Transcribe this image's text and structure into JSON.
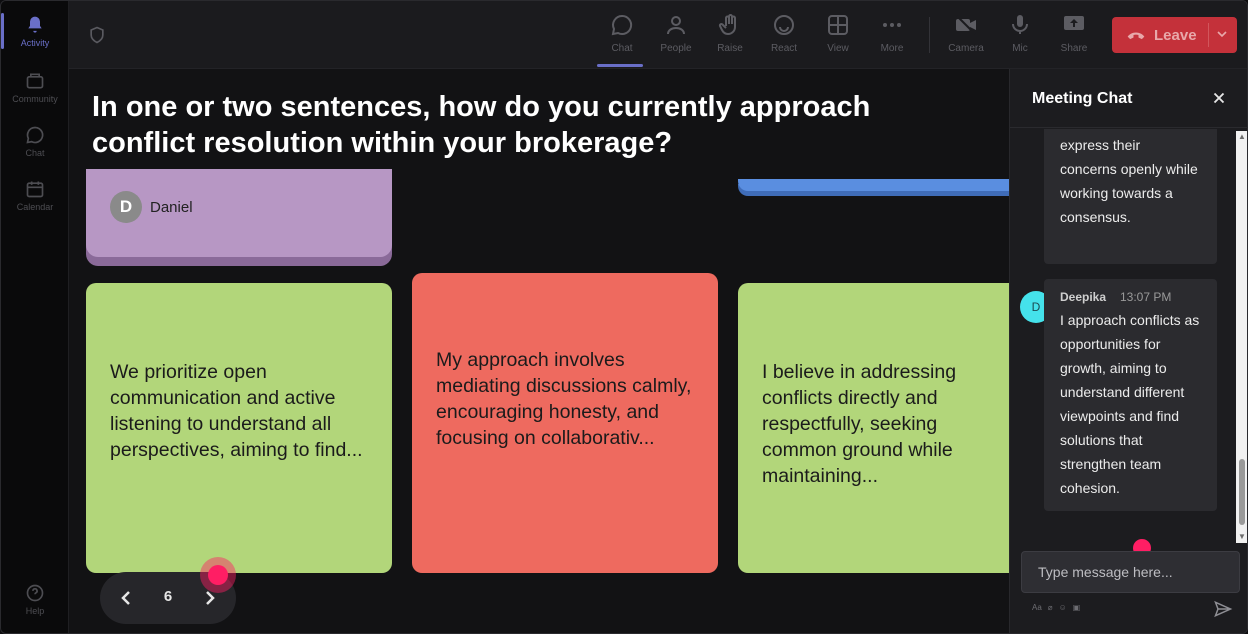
{
  "rail": {
    "items": [
      {
        "label": "Activity",
        "icon": "bell-icon"
      },
      {
        "label": "Community",
        "icon": "community-icon"
      },
      {
        "label": "Chat",
        "icon": "chat-icon"
      },
      {
        "label": "Calendar",
        "icon": "calendar-icon"
      },
      {
        "label": "Help",
        "icon": "help-icon"
      }
    ]
  },
  "toolbar": {
    "chat": "Chat",
    "people": "People",
    "raise": "Raise",
    "react": "React",
    "view": "View",
    "more": "More",
    "camera": "Camera",
    "mic": "Mic",
    "share": "Share",
    "leave": "Leave"
  },
  "stage": {
    "question": "In one or two sentences, how do you currently approach conflict resolution within your brokerage?",
    "top_card": {
      "avatar_initial": "D",
      "author": "Daniel"
    },
    "cards": [
      {
        "text": "We prioritize open communication and active listening to understand all perspectives, aiming to find..."
      },
      {
        "text": "My approach involves mediating discussions calmly, encouraging honesty, and focusing on collaborativ..."
      },
      {
        "text": "I believe in addressing conflicts directly and respectfully, seeking common ground while maintaining..."
      }
    ],
    "page_number": "6"
  },
  "chat": {
    "title": "Meeting Chat",
    "messages": [
      {
        "text": "express their concerns openly while working towards a consensus."
      },
      {
        "avatar_initial": "D",
        "author": "Deepika",
        "time": "13:07 PM",
        "text": "I approach conflicts as opportunities for growth, aiming to understand different viewpoints and find solutions that strengthen team cohesion."
      }
    ],
    "input_placeholder": "Type message here..."
  },
  "colors": {
    "accent": "#6a6fc8",
    "leave": "#c4313a",
    "card_green": "#b2d67a",
    "card_red": "#ee6a5f",
    "card_purple": "#b797c4",
    "card_blue": "#5a8ee0",
    "cursor": "#ff1e64"
  }
}
